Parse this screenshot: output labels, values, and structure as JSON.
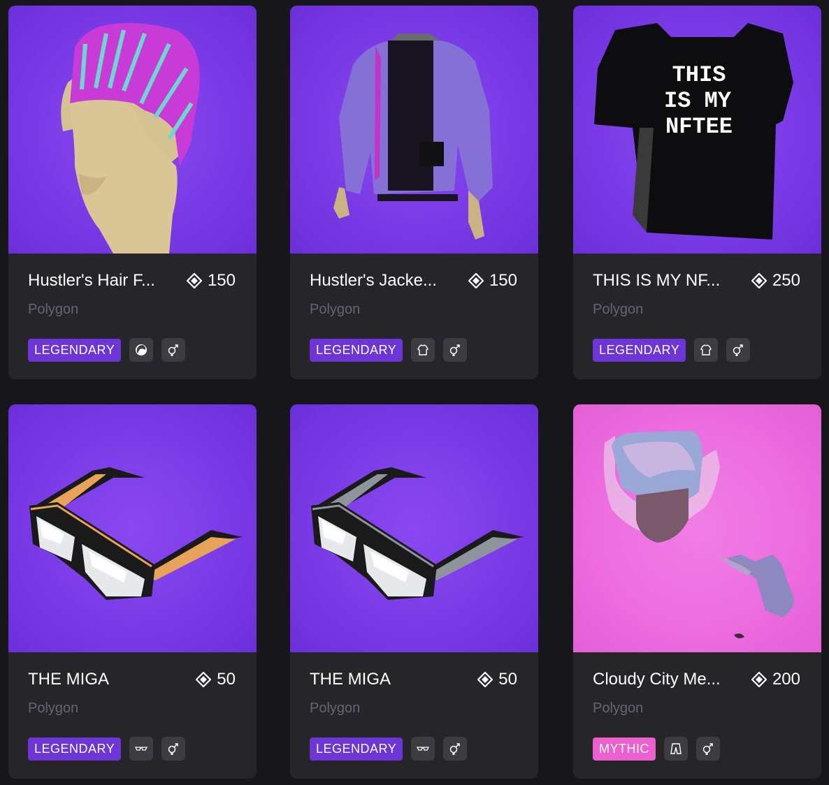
{
  "cards": [
    {
      "title": "Hustler's Hair F...",
      "price": "150",
      "network": "Polygon",
      "rarity": "LEGENDARY",
      "category_icon": "hair-icon",
      "gender_icon": "unisex-icon",
      "preview": "hair"
    },
    {
      "title": "Hustler's Jacke...",
      "price": "150",
      "network": "Polygon",
      "rarity": "LEGENDARY",
      "category_icon": "upper-body-icon",
      "gender_icon": "unisex-icon",
      "preview": "jacket"
    },
    {
      "title": "THIS IS MY NF...",
      "price": "250",
      "network": "Polygon",
      "rarity": "LEGENDARY",
      "category_icon": "upper-body-icon",
      "gender_icon": "unisex-icon",
      "preview": "tshirt",
      "shirt_text": [
        "THIS",
        "IS MY",
        "NFTEE"
      ]
    },
    {
      "title": "THE MIGA",
      "price": "50",
      "network": "Polygon",
      "rarity": "LEGENDARY",
      "category_icon": "eyewear-icon",
      "gender_icon": "unisex-icon",
      "preview": "glasses-orange"
    },
    {
      "title": "THE MIGA",
      "price": "50",
      "network": "Polygon",
      "rarity": "LEGENDARY",
      "category_icon": "eyewear-icon",
      "gender_icon": "unisex-icon",
      "preview": "glasses-gray"
    },
    {
      "title": "Cloudy City Me...",
      "price": "200",
      "network": "Polygon",
      "rarity": "MYTHIC",
      "category_icon": "lower-body-icon",
      "gender_icon": "unisex-icon",
      "preview": "cloudy"
    }
  ],
  "colors": {
    "background": "#17161b",
    "card": "#26252a",
    "legendary": "#6d34d6",
    "mythic": "#ec5fcf",
    "thumb_purple": "#7a3be6",
    "thumb_pink": "#ec6ce0"
  }
}
